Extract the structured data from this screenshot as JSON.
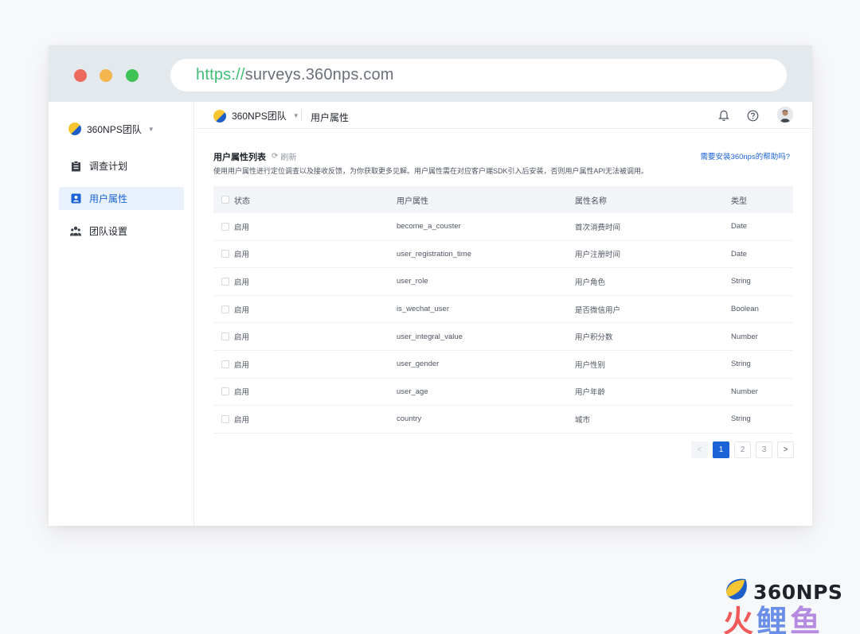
{
  "browser": {
    "url_scheme": "https://",
    "url_host": "surveys.360nps.com"
  },
  "sidebar": {
    "team_name": "360NPS团队",
    "items": [
      {
        "label": "调查计划",
        "icon": "clipboard-icon",
        "active": false
      },
      {
        "label": "用户属性",
        "icon": "user-card-icon",
        "active": true
      },
      {
        "label": "团队设置",
        "icon": "team-icon",
        "active": false
      }
    ]
  },
  "topbar": {
    "team_name": "360NPS团队",
    "breadcrumb": "用户属性",
    "icons": [
      "bell-icon",
      "help-icon",
      "avatar"
    ]
  },
  "content": {
    "title": "用户属性列表",
    "refresh_label": "刷新",
    "description": "使用用户属性进行定位调查以及接收反馈，为你获取更多见解。用户属性需在对应客户端SDK引入后安装，否则用户属性API无法被调用。",
    "help_link": "需要安装360nps的帮助吗?"
  },
  "table": {
    "headers": [
      "状态",
      "用户属性",
      "属性名称",
      "类型"
    ],
    "rows": [
      {
        "status": "启用",
        "attr": "become_a_couster",
        "name": "首次消费时间",
        "type": "Date"
      },
      {
        "status": "启用",
        "attr": "user_registration_time",
        "name": "用户注册时间",
        "type": "Date"
      },
      {
        "status": "启用",
        "attr": "user_role",
        "name": "用户角色",
        "type": "String"
      },
      {
        "status": "启用",
        "attr": "is_wechat_user",
        "name": "是否微信用户",
        "type": "Boolean"
      },
      {
        "status": "启用",
        "attr": "user_integral_value",
        "name": "用户积分数",
        "type": "Number"
      },
      {
        "status": "启用",
        "attr": "user_gender",
        "name": "用户性别",
        "type": "String"
      },
      {
        "status": "启用",
        "attr": "user_age",
        "name": "用户年龄",
        "type": "Number"
      },
      {
        "status": "启用",
        "attr": "country",
        "name": "城市",
        "type": "String"
      }
    ]
  },
  "pagination": {
    "prev": "<",
    "pages": [
      "1",
      "2",
      "3"
    ],
    "current": "1",
    "next": ">"
  },
  "watermark": {
    "brand": "360NPS",
    "sub": [
      "火",
      "鲤",
      "鱼"
    ]
  },
  "colors": {
    "accent": "#1c63d8",
    "active_bg": "#e9f1fd",
    "url_green": "#3fbf75"
  }
}
